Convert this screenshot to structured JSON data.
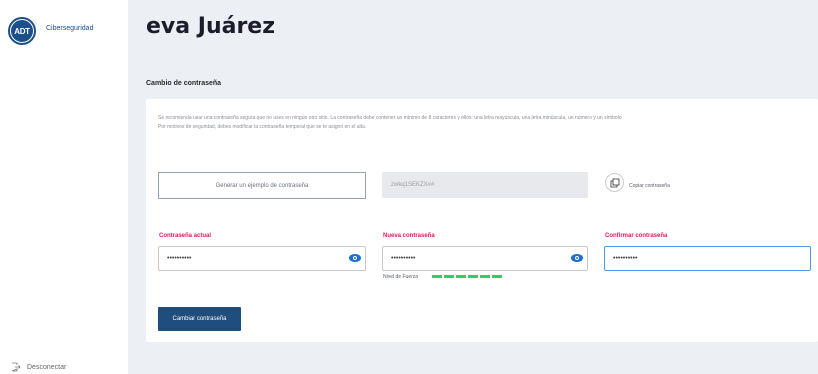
{
  "sidebar": {
    "logo_text": "ADT",
    "brand_label": "Ciberseguridad",
    "logout_label": "Desconectar"
  },
  "header": {
    "user_name": "eva Juárez"
  },
  "section": {
    "title": "Cambio de contraseña"
  },
  "card": {
    "description_line1": "Se recomienda usar una contraseña segura que no uses en ningún otro sitio. La contraseña debe contener un mínimo de 8 caracteres y ellos: una letra mayúscula, una letra minúscula, un número y un símbolo",
    "description_line2": "Por motivos de seguridad, debes modificar la contraseña temporal que se te asignó en el alta.",
    "generate_button": "Generar un ejemplo de contraseña",
    "example_password": "zwkq1SEKZX##",
    "copy_label": "Copiar contraseña",
    "fields": [
      {
        "label": "Contraseña actual",
        "value": "••••••••••"
      },
      {
        "label": "Nueva contraseña",
        "value": "••••••••••"
      },
      {
        "label": "Confirmar contraseña",
        "value": "••••••••••"
      }
    ],
    "strength_label": "Nivel de Fuerza",
    "strength_segments": 6,
    "submit_button": "Cambiar contraseña"
  },
  "colors": {
    "brand": "#1b4f8a",
    "label_accent": "#e4195c",
    "strength": "#26d26a",
    "eye_icon": "#1b6fd0",
    "submit_bg": "#1f4e7d"
  }
}
